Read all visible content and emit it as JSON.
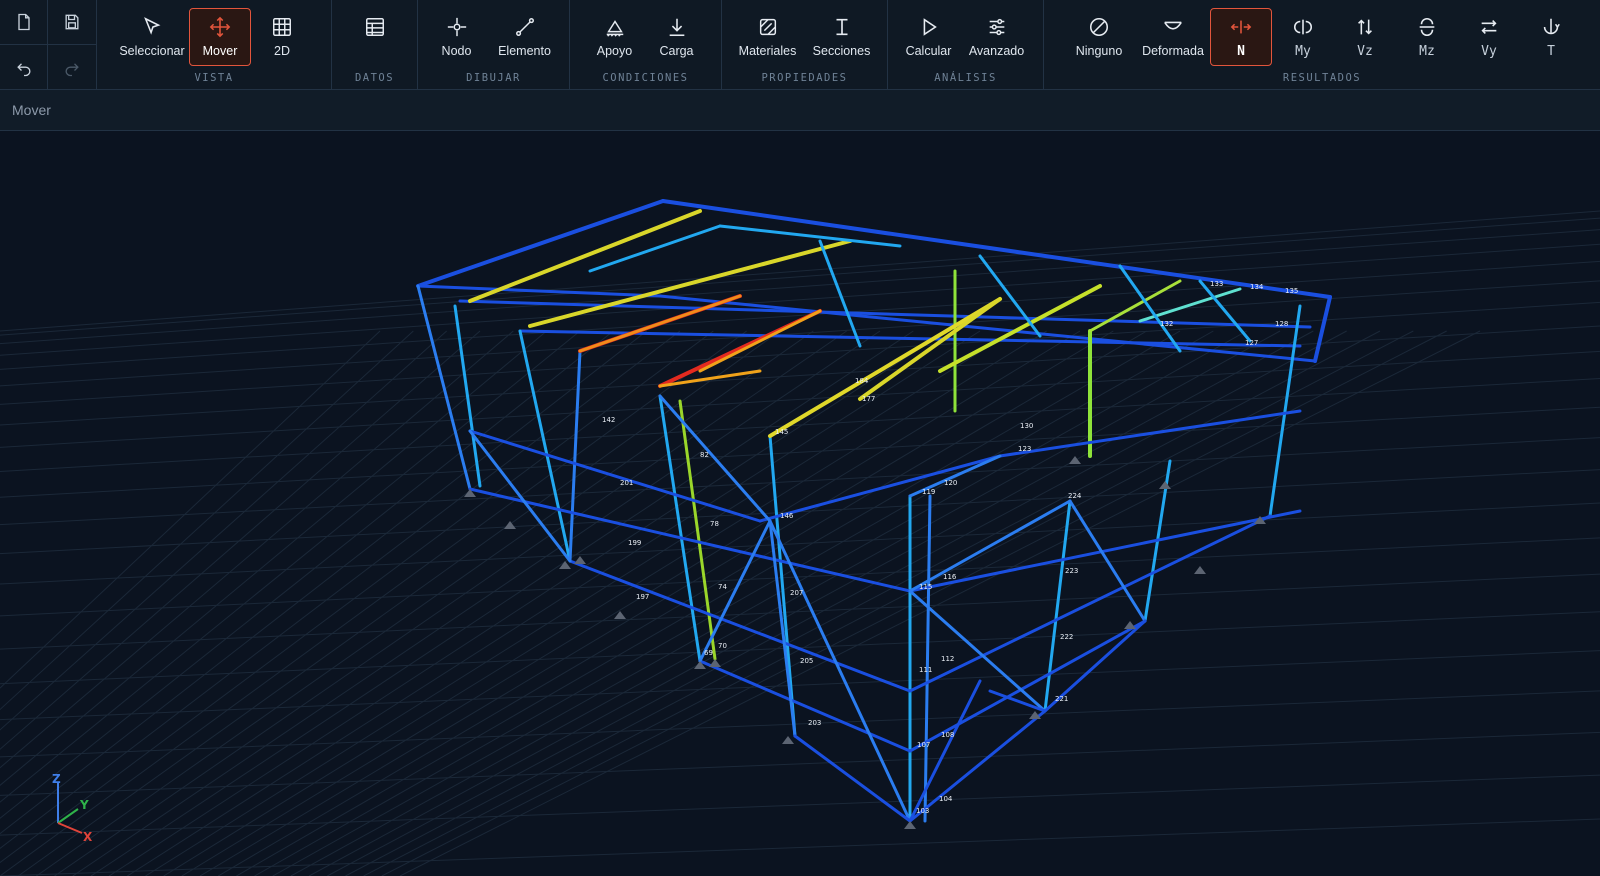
{
  "toolbar": {
    "file": {
      "new_icon": "file-icon",
      "save_icon": "save-icon",
      "undo_icon": "undo-icon",
      "redo_icon": "redo-icon"
    },
    "groups": {
      "vista": {
        "label": "VISTA",
        "seleccionar": "Seleccionar",
        "mover": "Mover",
        "dos_d": "2D"
      },
      "datos": {
        "label": "DATOS"
      },
      "dibujar": {
        "label": "DIBUJAR",
        "nodo": "Nodo",
        "elemento": "Elemento"
      },
      "condiciones": {
        "label": "CONDICIONES",
        "apoyo": "Apoyo",
        "carga": "Carga"
      },
      "propiedades": {
        "label": "PROPIEDADES",
        "materiales": "Materiales",
        "secciones": "Secciones"
      },
      "analisis": {
        "label": "ANÁLISIS",
        "calcular": "Calcular",
        "avanzado": "Avanzado"
      },
      "resultados": {
        "label": "RESULTADOS",
        "ninguno": "Ninguno",
        "deformada": "Deformada",
        "n": "N",
        "my": "My",
        "vz": "Vz",
        "mz": "Mz",
        "vy": "Vy",
        "t": "T"
      }
    },
    "active_tool": "Mover",
    "active_result": "N",
    "accent_color": "#e2553c"
  },
  "status": {
    "text": "Mover"
  },
  "viewport": {
    "axes": {
      "z": "Z",
      "y": "Y",
      "x": "X"
    },
    "node_labels": [
      "133",
      "134",
      "135",
      "132",
      "128",
      "127",
      "184",
      "177",
      "145",
      "130",
      "123",
      "120",
      "119",
      "146",
      "116",
      "115",
      "112",
      "111",
      "108",
      "107",
      "104",
      "103",
      "207",
      "205",
      "203",
      "224",
      "223",
      "222",
      "221",
      "142",
      "201",
      "199",
      "197",
      "82",
      "78",
      "74",
      "70",
      "69"
    ]
  }
}
